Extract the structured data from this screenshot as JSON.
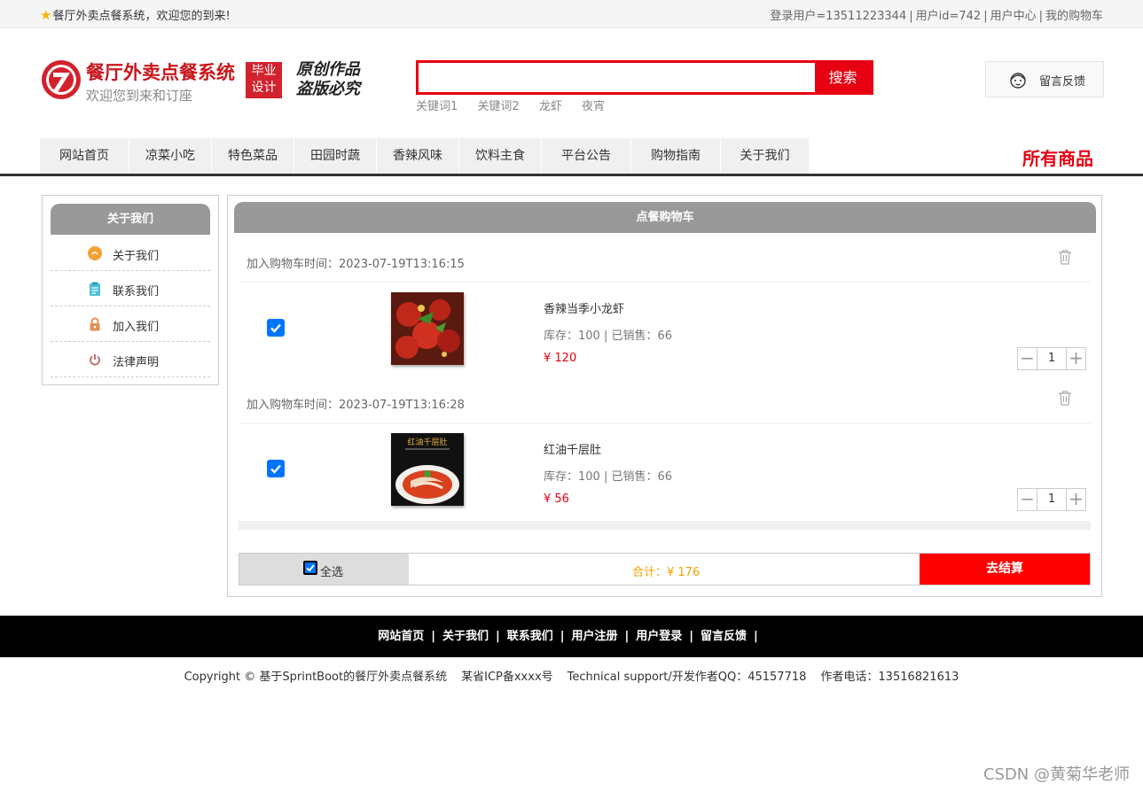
{
  "topbar": {
    "welcome": "餐厅外卖点餐系统，欢迎您的到来!",
    "user_info": "登录用户=13511223344",
    "user_id": "用户id=742",
    "user_center": "用户中心",
    "my_cart": "我的购物车"
  },
  "brand": {
    "title": "餐厅外卖点餐系统",
    "subtitle": "欢迎您到来和订座",
    "badge_line1": "毕业",
    "badge_line2": "设计",
    "slogan_line1": "原创作品",
    "slogan_line2": "盗版必究"
  },
  "search": {
    "value": "",
    "button": "搜索",
    "keywords": [
      "关键词1",
      "关键词2",
      "龙虾",
      "夜宵"
    ]
  },
  "feedback": {
    "label": "留言反馈"
  },
  "nav": {
    "items": [
      "网站首页",
      "凉菜小吃",
      "特色菜品",
      "田园时蔬",
      "香辣风味",
      "饮料主食",
      "平台公告",
      "购物指南",
      "关于我们"
    ],
    "all_goods": "所有商品"
  },
  "sidebar": {
    "title": "关于我们",
    "items": [
      {
        "label": "关于我们",
        "icon": "about-icon",
        "color": "#f7a035"
      },
      {
        "label": "联系我们",
        "icon": "contact-icon",
        "color": "#4bc0d9"
      },
      {
        "label": "加入我们",
        "icon": "lock-icon",
        "color": "#e0905a"
      },
      {
        "label": "法律声明",
        "icon": "power-icon",
        "color": "#c07070"
      }
    ]
  },
  "cart": {
    "title": "点餐购物车",
    "items": [
      {
        "time": "加入购物车时间：2023-07-19T13:16:15",
        "name": "香辣当季小龙虾",
        "stock": "库存：100 | 已销售：66",
        "price": "¥ 120",
        "qty": "1",
        "checked": true,
        "image": "crayfish"
      },
      {
        "time": "加入购物车时间：2023-07-19T13:16:28",
        "name": "红油千层肚",
        "stock": "库存：100 | 已销售：66",
        "price": "¥ 56",
        "qty": "1",
        "checked": true,
        "image": "tripe",
        "image_caption": "红油千层肚"
      }
    ],
    "select_all": "全选",
    "total": "合计：¥ 176",
    "checkout": "去结算"
  },
  "footer": {
    "links": [
      "网站首页",
      "关于我们",
      "联系我们",
      "用户注册",
      "用户登录",
      "留言反馈"
    ],
    "copyright": "Copyright © 基于SprintBoot的餐厅外卖点餐系统",
    "icp": "某省ICP备xxxx号",
    "support": "Technical support/开发作者QQ：45157718",
    "phone": "作者电话：13516821613"
  },
  "watermark": "CSDN @黄菊华老师",
  "colors": {
    "accent": "#e60012",
    "header_gray": "#999999",
    "total": "#f0a000"
  }
}
